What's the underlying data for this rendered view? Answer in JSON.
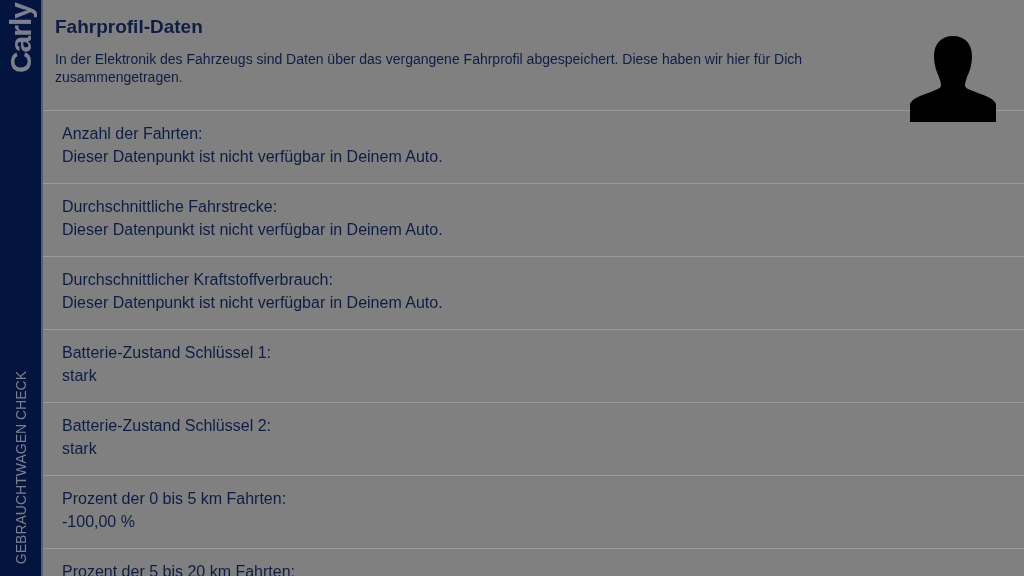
{
  "sidebar": {
    "logo": "Carly",
    "caption": "GEBRAUCHTWAGEN CHECK"
  },
  "header": {
    "title": "Fahrprofil-Daten",
    "description": "In der Elektronik des Fahrzeugs sind Daten über das vergangene Fahrprofil abgespeichert. Diese haben wir hier für Dich zusammengetragen."
  },
  "items": [
    {
      "label": "Anzahl der Fahrten:",
      "value": "Dieser Datenpunkt ist nicht verfügbar in Deinem Auto."
    },
    {
      "label": "Durchschnittliche Fahrstrecke:",
      "value": "Dieser Datenpunkt ist nicht verfügbar in Deinem Auto."
    },
    {
      "label": "Durchschnittlicher Kraftstoffverbrauch:",
      "value": "Dieser Datenpunkt ist nicht verfügbar in Deinem Auto."
    },
    {
      "label": "Batterie-Zustand Schlüssel 1:",
      "value": "stark"
    },
    {
      "label": "Batterie-Zustand Schlüssel 2:",
      "value": "stark"
    },
    {
      "label": "Prozent der 0 bis 5 km Fahrten:",
      "value": "-100,00 %"
    },
    {
      "label": "Prozent der 5 bis 20 km Fahrten:"
    }
  ]
}
